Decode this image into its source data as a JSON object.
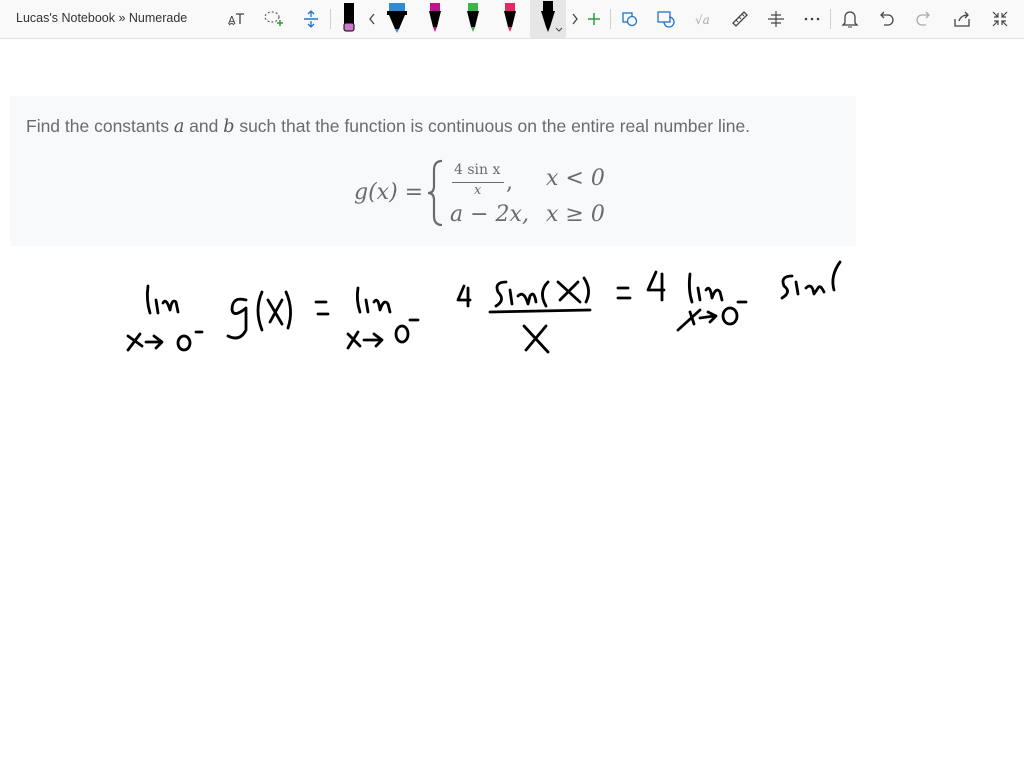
{
  "window": {
    "title": "Lucas's Notebook » Numerade"
  },
  "toolbar": {
    "tools": [
      {
        "name": "text-to-ink",
        "icon": "text-icon"
      },
      {
        "name": "lasso-select",
        "icon": "lasso-icon"
      },
      {
        "name": "add-space",
        "icon": "add-space-icon"
      },
      {
        "name": "pens-prev",
        "icon": "chevron-left-icon"
      },
      {
        "name": "pens-next",
        "icon": "chevron-right-icon"
      },
      {
        "name": "add-pen",
        "icon": "plus-icon"
      },
      {
        "name": "ink-to-shape",
        "icon": "shape-icon"
      },
      {
        "name": "ink-replay",
        "icon": "replay-icon"
      },
      {
        "name": "ink-to-math",
        "icon": "math-icon"
      },
      {
        "name": "ruler",
        "icon": "ruler-icon"
      },
      {
        "name": "position",
        "icon": "position-icon"
      },
      {
        "name": "more",
        "icon": "more-icon"
      },
      {
        "name": "notifications",
        "icon": "bell-icon"
      },
      {
        "name": "undo",
        "icon": "undo-icon"
      },
      {
        "name": "redo",
        "icon": "redo-icon"
      },
      {
        "name": "share",
        "icon": "share-icon"
      },
      {
        "name": "collapse",
        "icon": "collapse-icon"
      }
    ],
    "pens": [
      {
        "color": "#000000",
        "tip": "#cc66cc",
        "type": "highlighter"
      },
      {
        "color": "#2e8bd6",
        "type": "pen"
      },
      {
        "color": "#c0138f",
        "type": "pen"
      },
      {
        "color": "#39b54a",
        "type": "pen"
      },
      {
        "color": "#e8246a",
        "type": "pen"
      },
      {
        "color": "#000000",
        "type": "pen",
        "selected": true
      }
    ]
  },
  "problem": {
    "prompt_parts": [
      "Find the constants ",
      "a",
      " and ",
      "b",
      " such that the function is continuous on the entire real number line."
    ],
    "function_lhs": "g(x) =",
    "case1_num": "4 sin x",
    "case1_den": "x",
    "case1_sep": ",",
    "case1_cond": "x < 0",
    "case2_expr": "a − 2x,",
    "case2_cond": "x ≥ 0"
  },
  "ink": {
    "color": "#000000"
  }
}
